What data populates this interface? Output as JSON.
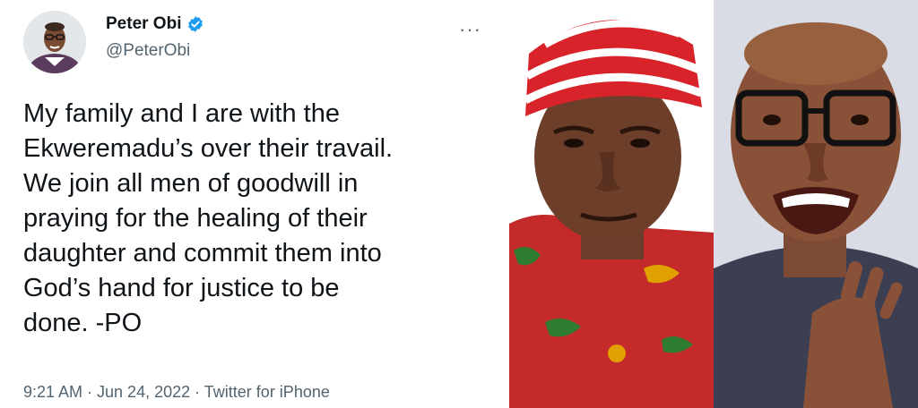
{
  "tweet": {
    "author_name": "Peter Obi",
    "handle": "@PeterObi",
    "verified": true,
    "more_menu": "···",
    "text": "My family and I are with the\nEkweremadu’s over their travail.\nWe join all men of goodwill in\npraying for the healing of their\ndaughter and commit them into\nGod’s hand for justice to be\ndone. -PO",
    "timestamp": "9:21 AM · Jun 24, 2022 · Twitter for iPhone"
  },
  "colors": {
    "verified_badge": "#1d9bf0",
    "text_primary": "#0f1419",
    "text_secondary": "#536471"
  },
  "icons": {
    "verified": "verified-badge-icon",
    "more": "more-options-icon"
  }
}
